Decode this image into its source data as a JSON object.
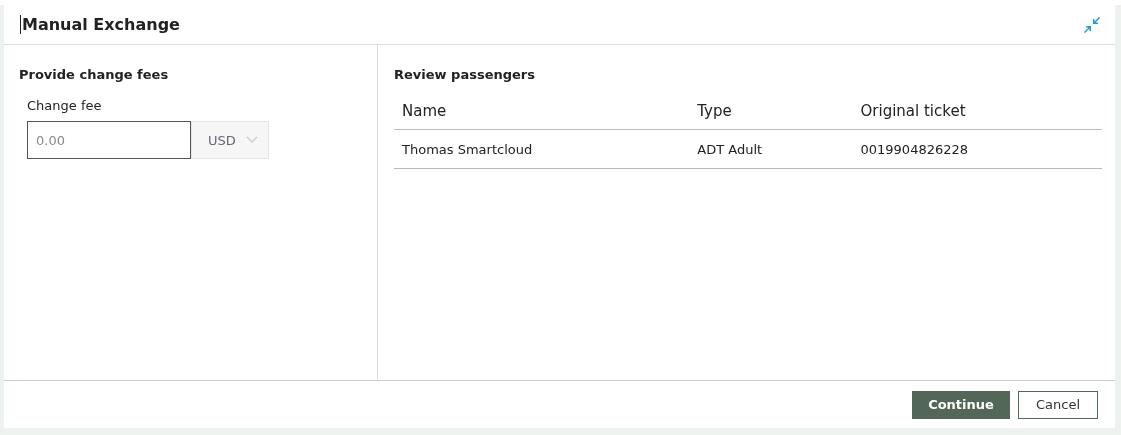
{
  "dialog": {
    "title": "Manual Exchange"
  },
  "fees": {
    "heading": "Provide change fees",
    "label": "Change fee",
    "placeholder": "0.00",
    "currency": "USD"
  },
  "passengers": {
    "heading": "Review passengers",
    "columns": [
      "Name",
      "Type",
      "Original ticket"
    ],
    "rows": [
      [
        "Thomas Smartcloud",
        "ADT Adult",
        "0019904826228"
      ]
    ]
  },
  "buttons": [
    {
      "label": "Continue",
      "kind": "primary"
    },
    {
      "label": "Cancel",
      "kind": "secondary"
    }
  ]
}
